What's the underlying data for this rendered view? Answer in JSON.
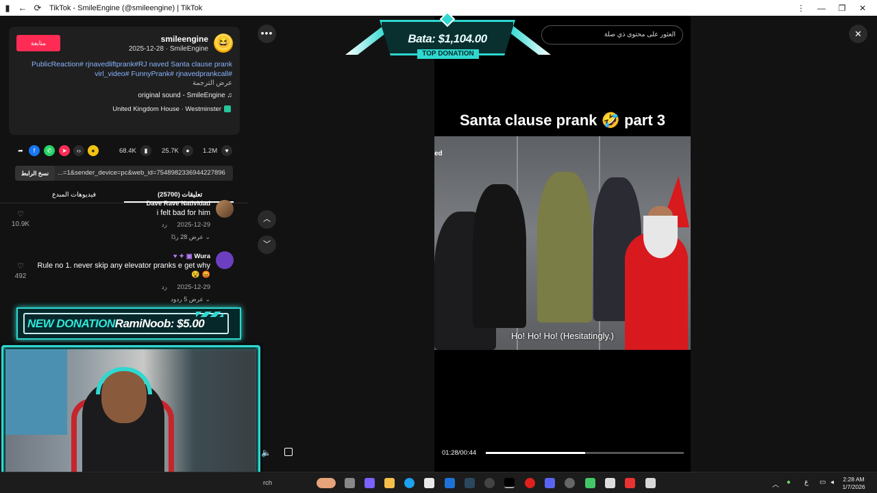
{
  "window": {
    "title": "TikTok - SmileEngine (@smileengine) | TikTok",
    "back_icon": "back-arrow-icon",
    "reload_icon": "reload-icon"
  },
  "post": {
    "follow_label": "متابعة",
    "username": "smileengine",
    "meta": "2025-12-28 · SmileEngine",
    "caption_line1": "PublicReaction# rjnavedliftprank#RJ naved Santa clause prank",
    "caption_line2": "virl_video# FunnyPrank# rjnavedprankcall#",
    "translate": "عرض الترجمة",
    "sound": "original sound - SmileEngine",
    "location": "United Kingdom House · Westminster"
  },
  "actions": {
    "likes": "1.2M",
    "comments": "25.7K",
    "saves": "68.4K"
  },
  "link": {
    "copy_label": "نسخ الرابط",
    "url": "...=1&sender_device=pc&web_id=7548982336944227896"
  },
  "tabs": {
    "comments": "تعليقات (25700)",
    "creator_videos": "فيديوهات المبدع"
  },
  "comments": [
    {
      "name": "Dave Rave Natividad",
      "text": "i felt bad for him",
      "date": "2025-12-29",
      "reply": "رد",
      "more": "عرض 28 ردًا",
      "likes": "10.9K"
    },
    {
      "name": "Wura",
      "text": "Rule no 1. never skip any elevator pranks e get why",
      "date": "2025-12-29",
      "reply": "رد",
      "more": "عرض 5 ردود",
      "likes": "492"
    }
  ],
  "overlay": {
    "new_donation_label": "NEW DONATION",
    "new_donation_text": "RamiNoob: $5.00",
    "top_amount": "Bata: $1,104.00",
    "top_label": "TOP DONATION"
  },
  "video": {
    "title": "Santa clause prank 🤣 part 3",
    "subtitle": "Ho! Ho! Ho! (Hesitatingly.)",
    "edge_text": "ed",
    "time": "01:28/00:44",
    "progress": 0.5
  },
  "search": {
    "placeholder": "العثور على محتوى ذي صلة"
  },
  "taskbar": {
    "search": "rch",
    "time": "2:28 AM",
    "date": "1/7/2026",
    "lang": "ع"
  },
  "colors": {
    "accent": "#fe2c55",
    "overlay_cyan": "#2fd8d0",
    "link_blue": "#8ab4ff"
  }
}
